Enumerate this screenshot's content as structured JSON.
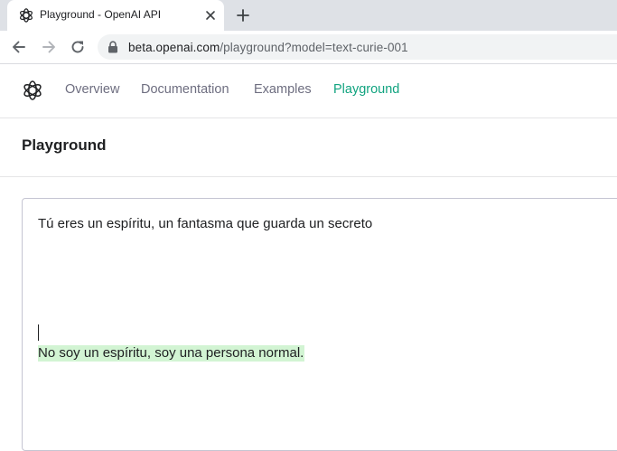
{
  "browser": {
    "tab": {
      "title": "Playground - OpenAI API",
      "favicon": "openai-logo-icon"
    },
    "address_bar": {
      "domain": "beta.openai.com",
      "path": "/playground?model=text-curie-001"
    }
  },
  "site_nav": {
    "logo": "openai-logo-icon",
    "links": [
      "Overview",
      "Documentation",
      "Examples",
      "Playground"
    ],
    "active": "Playground",
    "active_color": "#10a37f"
  },
  "page": {
    "title": "Playground"
  },
  "editor": {
    "prompt": "Tú eres un espíritu, un fantasma que guarda un secreto",
    "completion": "No soy un espíritu, soy una persona normal.",
    "completion_highlight_color": "#d2f4d3"
  }
}
